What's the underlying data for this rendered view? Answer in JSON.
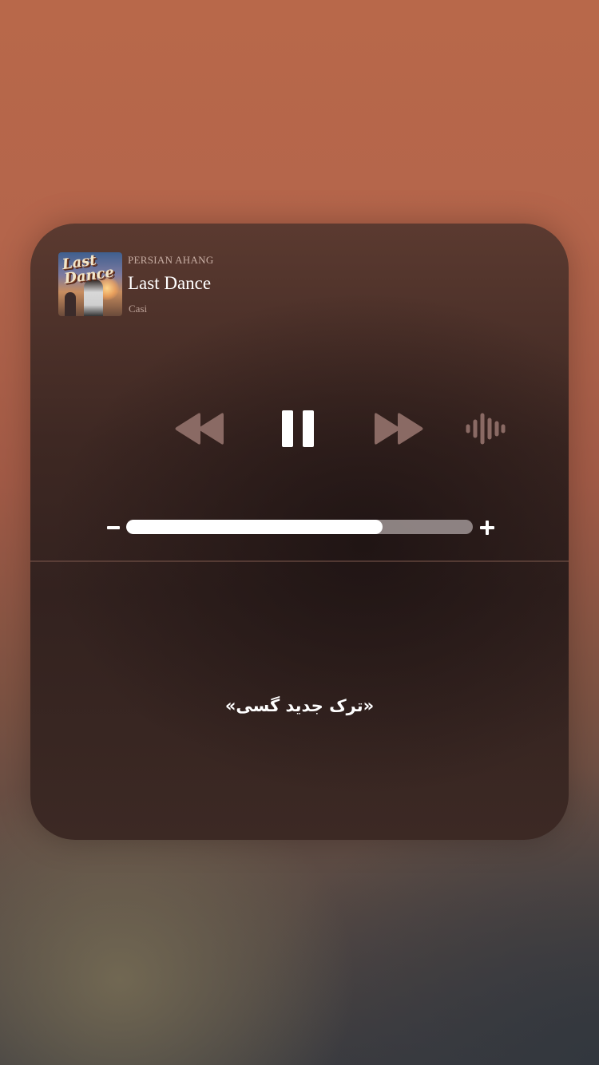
{
  "now_playing": {
    "app_name": "PERSIAN AHANG",
    "title": "Last Dance",
    "artist": "Casi",
    "album_art_text": "Last Dance"
  },
  "controls": {
    "rewind_icon": "rewind-icon",
    "pause_icon": "pause-icon",
    "forward_icon": "fast-forward-icon",
    "audio_icon": "audio-waveform-icon"
  },
  "volume": {
    "level": 0.74,
    "minus_icon": "minus-icon",
    "plus_icon": "plus-icon"
  },
  "caption": "«ترک جدید گسی»",
  "colors": {
    "icon_inactive": "#8a6a64",
    "icon_active": "#ffffff",
    "track": "#aaa0a0"
  }
}
